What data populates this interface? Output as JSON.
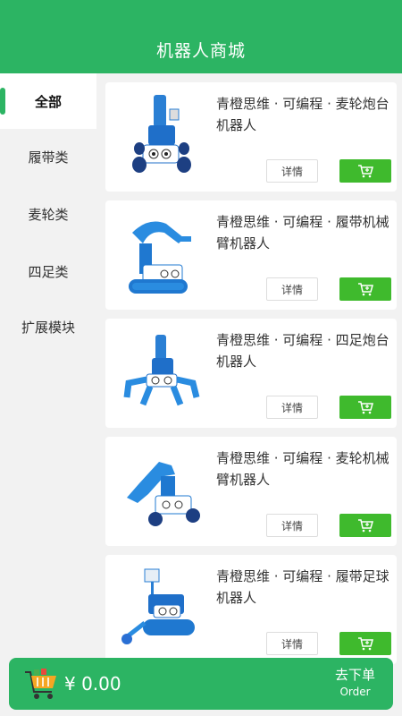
{
  "header": {
    "title": "机器人商城"
  },
  "sidebar": {
    "items": [
      {
        "label": "全部",
        "active": true
      },
      {
        "label": "履带类",
        "active": false
      },
      {
        "label": "麦轮类",
        "active": false
      },
      {
        "label": "四足类",
        "active": false
      },
      {
        "label": "扩展模块",
        "active": false
      }
    ]
  },
  "products": [
    {
      "name": "青橙思维 · 可编程 · 麦轮炮台机器人",
      "detail_label": "详情",
      "image": "robot-wheel-turret"
    },
    {
      "name": "青橙思维 · 可编程 · 履带机械臂机器人",
      "detail_label": "详情",
      "image": "robot-track-arm"
    },
    {
      "name": "青橙思维 · 可编程 · 四足炮台机器人",
      "detail_label": "详情",
      "image": "robot-legged-turret"
    },
    {
      "name": "青橙思维 · 可编程 · 麦轮机械臂机器人",
      "detail_label": "详情",
      "image": "robot-wheel-arm"
    },
    {
      "name": "青橙思维 · 可编程 · 履带足球机器人",
      "detail_label": "详情",
      "image": "robot-track-soccer"
    }
  ],
  "cart": {
    "total": "¥ 0.00",
    "order_cn": "去下单",
    "order_en": "Order",
    "icon": "basket-icon"
  },
  "colors": {
    "brand": "#2cb463",
    "cart_button": "#3fba2d"
  }
}
